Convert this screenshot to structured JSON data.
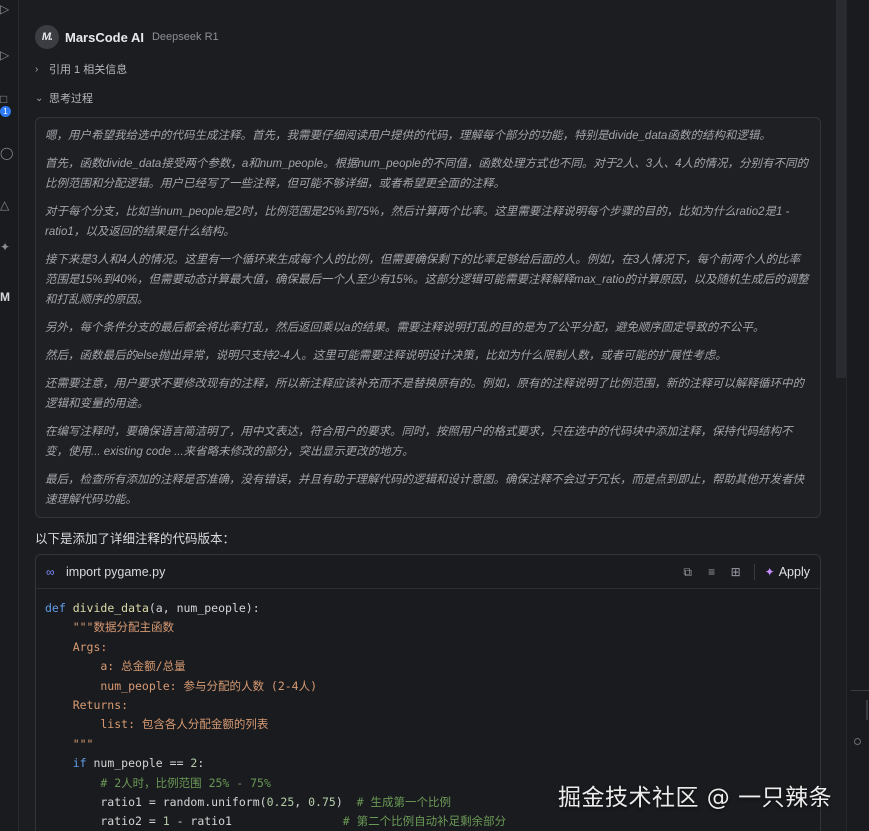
{
  "assistant": {
    "name": "MarsCode AI",
    "model": "Deepseek R1",
    "logo": "M."
  },
  "references": {
    "label": "引用 1 相关信息",
    "icon": "chevron-right-icon"
  },
  "thinking": {
    "label": "思考过程",
    "icon": "chevron-down-icon",
    "paragraphs": [
      "嗯，用户希望我给选中的代码生成注释。首先，我需要仔细阅读用户提供的代码，理解每个部分的功能，特别是divide_data函数的结构和逻辑。",
      "首先，函数divide_data接受两个参数，a和num_people。根据num_people的不同值，函数处理方式也不同。对于2人、3人、4人的情况，分别有不同的比例范围和分配逻辑。用户已经写了一些注释，但可能不够详细，或者希望更全面的注释。",
      "对于每个分支，比如当num_people是2时，比例范围是25%到75%，然后计算两个比率。这里需要注释说明每个步骤的目的，比如为什么ratio2是1 - ratio1，以及返回的结果是什么结构。",
      "接下来是3人和4人的情况。这里有一个循环来生成每个人的比例，但需要确保剩下的比率足够给后面的人。例如，在3人情况下，每个前两个人的比率范围是15%到40%，但需要动态计算最大值，确保最后一个人至少有15%。这部分逻辑可能需要注释解释max_ratio的计算原因，以及随机生成后的调整和打乱顺序的原因。",
      "另外，每个条件分支的最后都会将比率打乱，然后返回乘以a的结果。需要注释说明打乱的目的是为了公平分配，避免顺序固定导致的不公平。",
      "然后，函数最后的else抛出异常，说明只支持2-4人。这里可能需要注释说明设计决策，比如为什么限制人数，或者可能的扩展性考虑。",
      "还需要注意，用户要求不要修改现有的注释，所以新注释应该补充而不是替换原有的。例如，原有的注释说明了比例范围，新的注释可以解释循环中的逻辑和变量的用途。",
      "在编写注释时，要确保语言简洁明了，用中文表达，符合用户的要求。同时，按照用户的格式要求，只在选中的代码块中添加注释，保持代码结构不变，使用... existing code ...来省略未修改的部分，突出显示更改的地方。",
      "最后，检查所有添加的注释是否准确，没有错误，并且有助于理解代码的逻辑和设计意图。确保注释不会过于冗长，而是点到即止，帮助其他开发者快速理解代码功能。"
    ]
  },
  "intro_text": "以下是添加了详细注释的代码版本：",
  "code_block": {
    "file_name": "import pygame.py",
    "file_icon": "link-icon",
    "apply_label": "Apply",
    "tools": [
      "copy-icon",
      "diff-icon",
      "insert-file-icon"
    ],
    "lines": [
      [
        [
          "kw",
          "def "
        ],
        [
          "fn",
          "divide_data"
        ],
        [
          "t",
          "(a, num_people):"
        ]
      ],
      [
        [
          "t",
          "    "
        ],
        [
          "str",
          "\"\"\"数据分配主函数"
        ]
      ],
      [
        [
          "str",
          "    Args:"
        ]
      ],
      [
        [
          "str",
          "        a: 总金额/总量"
        ]
      ],
      [
        [
          "str",
          "        num_people: 参与分配的人数 (2-4人)"
        ]
      ],
      [
        [
          "str",
          "    Returns:"
        ]
      ],
      [
        [
          "str",
          "        list: 包含各人分配金额的列表"
        ]
      ],
      [
        [
          "str",
          "    \"\"\""
        ]
      ],
      [
        [
          "t",
          "    "
        ],
        [
          "kw",
          "if"
        ],
        [
          "t",
          " num_people == "
        ],
        [
          "num",
          "2"
        ],
        [
          "t",
          ":"
        ]
      ],
      [
        [
          "t",
          "        "
        ],
        [
          "cm",
          "# 2人时，比例范围 25% - 75%"
        ]
      ],
      [
        [
          "t",
          "        ratio1 = random.uniform("
        ],
        [
          "num",
          "0.25"
        ],
        [
          "t",
          ", "
        ],
        [
          "num",
          "0.75"
        ],
        [
          "t",
          ")  "
        ],
        [
          "cm",
          "# 生成第一个比例"
        ]
      ],
      [
        [
          "t",
          "        ratio2 = "
        ],
        [
          "num",
          "1"
        ],
        [
          "t",
          " - ratio1                "
        ],
        [
          "cm",
          "# 第二个比例自动补足剩余部分"
        ]
      ]
    ]
  },
  "watermark": "掘金技术社区 @ 一只辣条",
  "activity_badge": "1"
}
